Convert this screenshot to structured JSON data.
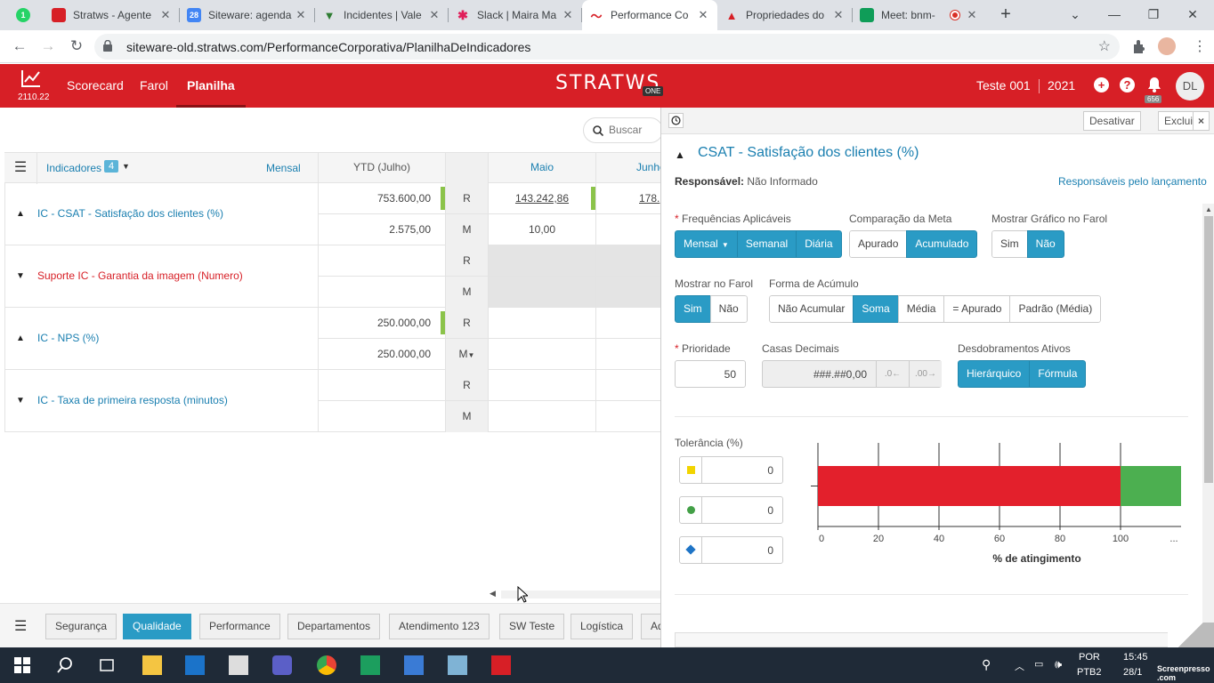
{
  "browser": {
    "tabs": [
      {
        "title": "Stratws - Agente",
        "favicon": "stratws-icon",
        "color": "#d71f26"
      },
      {
        "title": "Siteware: agenda",
        "favicon": "calendar-icon",
        "color": "#4285f4"
      },
      {
        "title": "Incidentes | Vale",
        "favicon": "vale-icon",
        "color": "#2e7d32"
      },
      {
        "title": "Slack | Maira Ma",
        "favicon": "slack-icon",
        "color": "#611f69"
      },
      {
        "title": "Performance Co",
        "favicon": "stratws-icon",
        "color": "#d71f26"
      },
      {
        "title": "Propriedades do",
        "favicon": "stratws-icon",
        "color": "#d71f26"
      },
      {
        "title": "Meet: bnm-",
        "favicon": "meet-icon",
        "color": "#0f9d58"
      }
    ],
    "first_tab_badge": "1",
    "calendar_badge": "28",
    "url": "siteware-old.stratws.com/PerformanceCorporativa/PlanilhaDeIndicadores"
  },
  "app": {
    "version": "2110.22",
    "nav": [
      "Scorecard",
      "Farol",
      "Planilha"
    ],
    "brand": "STRATWS",
    "brand_suffix": "ONE",
    "user": "Teste 001",
    "year": "2021",
    "notifications": "656",
    "avatar": "DL",
    "plus_label": "+",
    "help_label": "?"
  },
  "sheet": {
    "search_placeholder": "Buscar",
    "indicators_label": "Indicadores",
    "indicators_count": "4",
    "period": "Mensal",
    "ytd_label": "YTD (Julho)",
    "months": [
      "Maio",
      "Junho"
    ],
    "rows": [
      {
        "name": "IC - CSAT - Satisfação dos clientes (%)",
        "expanded": true,
        "ytd_r": "753.600,00",
        "ytd_m": "2.575,00",
        "maio_r": "143.242,86",
        "maio_m": "10,00",
        "jun_r": "178.",
        "jun_m": ""
      },
      {
        "name": "Suporte IC - Garantia da imagem (Numero)",
        "expanded": false,
        "ytd_r": "",
        "ytd_m": "",
        "maio_r": "",
        "maio_m": "",
        "jun_r": "",
        "jun_m": ""
      },
      {
        "name": "IC - NPS (%)",
        "expanded": true,
        "ytd_r": "250.000,00",
        "ytd_m": "250.000,00",
        "maio_r": "",
        "maio_m": "",
        "jun_r": "",
        "jun_m": ""
      },
      {
        "name": "IC - Taxa de primeira resposta (minutos)",
        "expanded": false,
        "ytd_r": "",
        "ytd_m": "",
        "maio_r": "",
        "maio_m": "",
        "jun_r": "",
        "jun_m": ""
      }
    ],
    "r_label": "R",
    "m_label": "M",
    "bottom_tabs": [
      "Segurança",
      "Qualidade",
      "Performance",
      "Departamentos",
      "Atendimento 123",
      "SW Teste",
      "Logística",
      "Ad"
    ]
  },
  "panel": {
    "deactivate": "Desativar",
    "delete": "Excluir",
    "close": "×",
    "title": "CSAT - Satisfação dos clientes (%)",
    "responsible_label": "Responsável:",
    "responsible_value": "Não Informado",
    "responsibles_link": "Responsáveis pelo lançamento",
    "freq_label": "Frequências Aplicáveis",
    "freq_options": [
      "Mensal",
      "Semanal",
      "Diária"
    ],
    "comp_label": "Comparação da Meta",
    "comp_options": [
      "Apurado",
      "Acumulado"
    ],
    "graph_label": "Mostrar Gráfico no Farol",
    "graph_options": [
      "Sim",
      "Não"
    ],
    "show_label": "Mostrar no Farol",
    "show_options": [
      "Sim",
      "Não"
    ],
    "accum_label": "Forma de Acúmulo",
    "accum_options": [
      "Não Acumular",
      "Soma",
      "Média",
      "= Apurado",
      "Padrão (Média)"
    ],
    "priority_label": "Prioridade",
    "priority_value": "50",
    "decimals_label": "Casas Decimais",
    "decimals_value": "###.##0,00",
    "unfold_label": "Desdobramentos Ativos",
    "unfold_options": [
      "Hierárquico",
      "Fórmula"
    ],
    "tolerance_label": "Tolerância (%)",
    "tolerance_values": [
      "0",
      "0",
      "0"
    ]
  },
  "chart_data": {
    "type": "bar",
    "orientation": "horizontal",
    "segments": [
      {
        "from": 0,
        "to": 100,
        "color": "#e3202c"
      },
      {
        "from": 100,
        "to": 120,
        "color": "#4caf50"
      }
    ],
    "xticks": [
      "0",
      "20",
      "40",
      "60",
      "80",
      "100",
      "..."
    ],
    "xlabel": "% de atingimento",
    "xlim": [
      0,
      120
    ]
  },
  "taskbar": {
    "lang": "POR",
    "layout": "PTB2",
    "time": "15:45",
    "date": "28/1",
    "screenpresso": "Screenpresso .com"
  }
}
